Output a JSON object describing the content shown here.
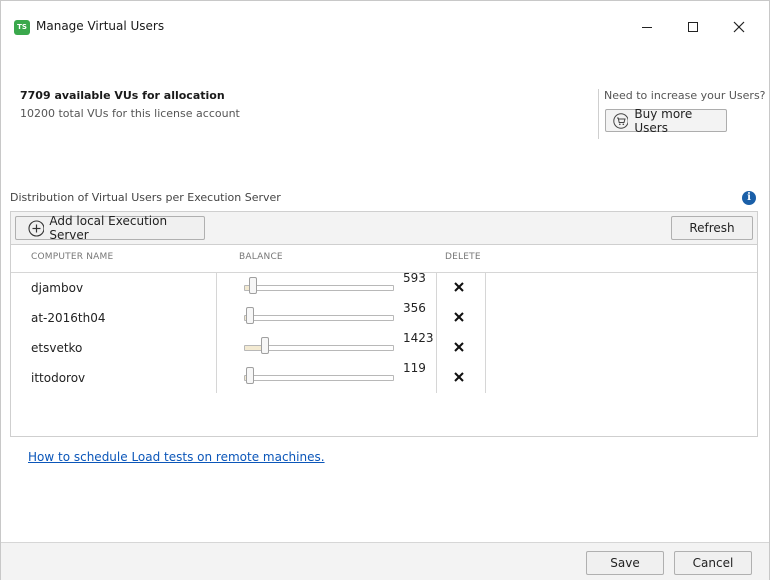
{
  "window": {
    "logo_text": "TS",
    "title": "Manage Virtual Users"
  },
  "license": {
    "available": "7709 available VUs for allocation",
    "total": "10200 total VUs for this license account"
  },
  "upsell": {
    "prompt": "Need to increase your Users?",
    "buy_label": "Buy more Users"
  },
  "distribution": {
    "label": "Distribution of Virtual Users per Execution Server",
    "info_glyph": "i"
  },
  "toolbar": {
    "add_label": "Add local Execution Server",
    "refresh_label": "Refresh"
  },
  "table": {
    "columns": [
      "COMPUTER NAME",
      "BALANCE",
      "DELETE"
    ],
    "rows": [
      {
        "name": "djambov",
        "value": "593",
        "fraction": 0.058
      },
      {
        "name": "at-2016th04",
        "value": "356",
        "fraction": 0.035
      },
      {
        "name": "etsvetko",
        "value": "1423",
        "fraction": 0.14
      },
      {
        "name": "ittodorov",
        "value": "119",
        "fraction": 0.012
      }
    ],
    "accent_fill": "#f3ead2"
  },
  "help_link": "How to schedule Load tests on remote machines.",
  "footer": {
    "save_label": "Save",
    "cancel_label": "Cancel"
  }
}
